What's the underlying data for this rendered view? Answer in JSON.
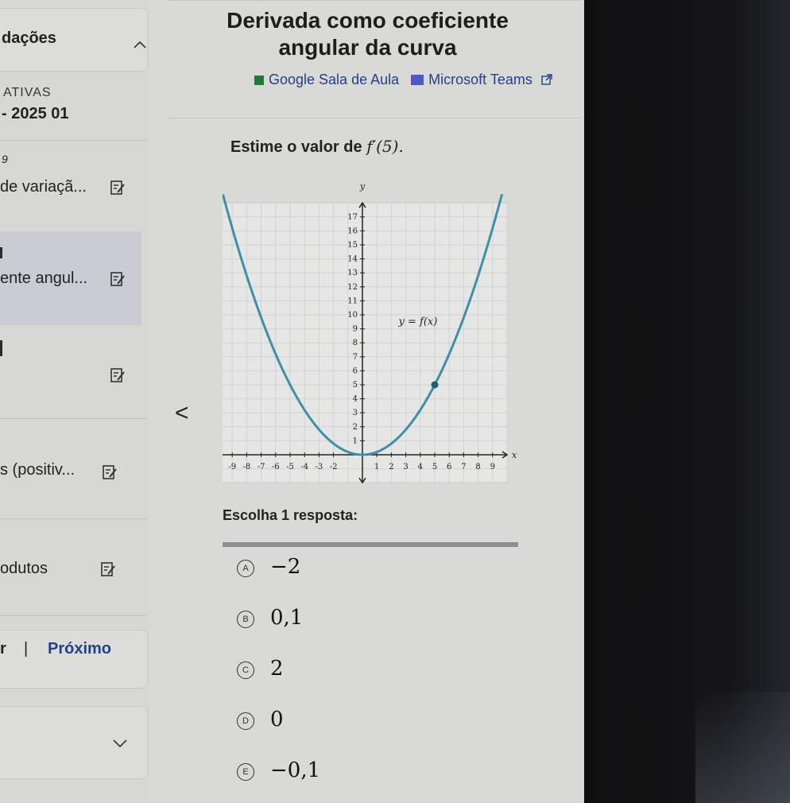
{
  "sidebar": {
    "section_title": "dações",
    "category": "ATIVAS",
    "period": "- 2025 01",
    "marker1": "9",
    "item1": "de variaçã...",
    "item2": "ente angul...",
    "item3": "s (positiv...",
    "item4": "odutos",
    "nav_prev": "r",
    "nav_sep": "|",
    "nav_next": "Próximo"
  },
  "page": {
    "title_line1": "Derivada como coeﬁciente",
    "title_line2": "angular da curva",
    "link_classroom": "Google Sala de Aula",
    "link_teams": "Microsoft Teams",
    "question": "Estime o valor de",
    "question_math": "f′(5).",
    "prompt": "Escolha 1 resposta:"
  },
  "options": [
    {
      "letter": "A",
      "value": "−2"
    },
    {
      "letter": "B",
      "value": "0,1"
    },
    {
      "letter": "C",
      "value": "2"
    },
    {
      "letter": "D",
      "value": "0"
    },
    {
      "letter": "E",
      "value": "−0,1"
    }
  ],
  "colors": {
    "curve": "#3f8fa8",
    "grid": "#cfd3d6",
    "accent_link": "#23408e"
  },
  "chart_data": {
    "type": "line",
    "curve_label": "y = f(x)",
    "xlabel": "x",
    "ylabel": "y",
    "xlim": [
      -10,
      10
    ],
    "ylim": [
      -2,
      18
    ],
    "x_ticks": [
      -9,
      -8,
      -7,
      -6,
      -5,
      -4,
      -3,
      -2,
      1,
      2,
      3,
      4,
      5,
      6,
      7,
      8,
      9
    ],
    "y_ticks": [
      1,
      2,
      3,
      4,
      5,
      6,
      7,
      8,
      9,
      10,
      11,
      12,
      13,
      14,
      15,
      16,
      17
    ],
    "series": [
      {
        "x": [
          -9.5,
          -8,
          -6,
          -4,
          -2,
          0,
          2,
          4,
          5,
          6,
          8,
          9.5
        ],
        "y": [
          18,
          12.8,
          7.2,
          3.2,
          0.8,
          0,
          0.8,
          3.2,
          5,
          7.2,
          12.8,
          18
        ]
      }
    ],
    "highlight_point": {
      "x": 5,
      "y": 5
    }
  }
}
